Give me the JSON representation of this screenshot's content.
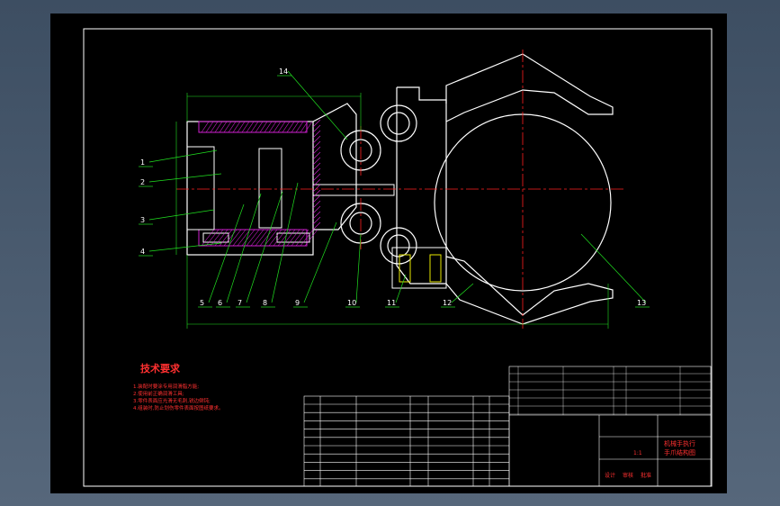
{
  "drawing": {
    "tech_title": "技术要求",
    "tech_notes": [
      "1.装配时要涂专用润滑脂方能;",
      "2.使用前正确润滑工具;",
      "3.零件表面应光滑无毛刺,锐边倒钝;",
      "4.组装时,防止划伤零件表面按图纸要求。"
    ],
    "part_numbers": [
      "1",
      "2",
      "3",
      "4",
      "5",
      "6",
      "7",
      "8",
      "9",
      "10",
      "11",
      "12",
      "13",
      "14"
    ],
    "title_block": {
      "drawing_title_1": "机械手执行",
      "drawing_title_2": "手爪结构图",
      "scale": "1:1",
      "role_labels": [
        "设计",
        "审核",
        "批准"
      ]
    },
    "colors": {
      "outline": "#ffffff",
      "centerline": "#ff2020",
      "hatch": "#d020d0",
      "dimension": "#20e020",
      "leader": "#20e020",
      "note": "#ff3030",
      "part": "#e8e800"
    }
  }
}
